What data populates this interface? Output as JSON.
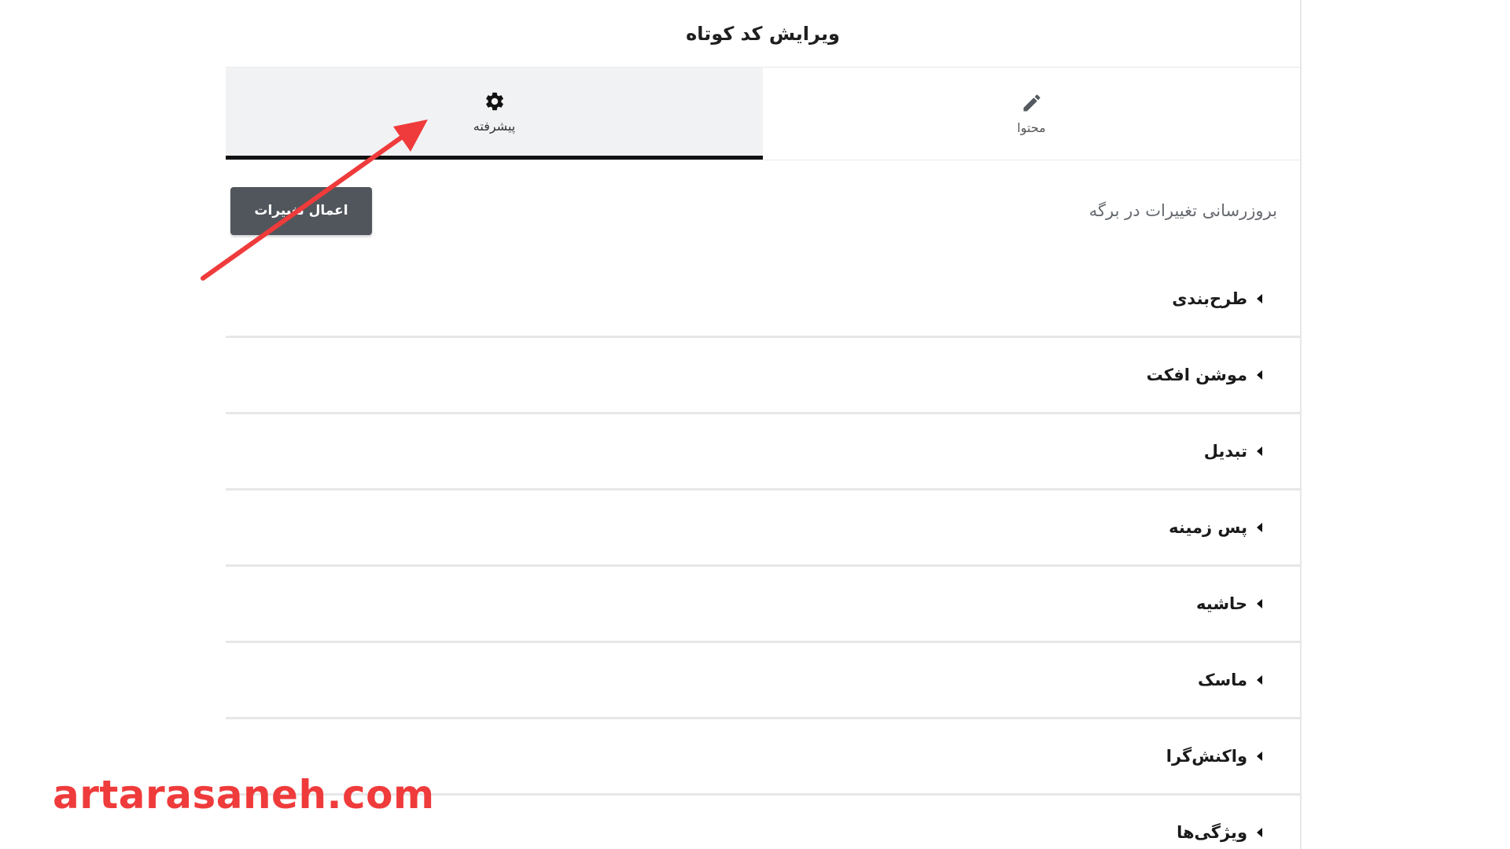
{
  "header": {
    "title": "ویرایش کد کوتاه"
  },
  "tabs": [
    {
      "label": "محتوا",
      "icon": "pencil-icon",
      "active": false
    },
    {
      "label": "پیشرفته",
      "icon": "gear-icon",
      "active": true
    }
  ],
  "sync": {
    "label": "بروزرسانی تغییرات در برگه",
    "button_label": "اعمال تغییرات"
  },
  "sections": [
    {
      "label": "طرح‌بندی"
    },
    {
      "label": "موشن افکت"
    },
    {
      "label": "تبدیل"
    },
    {
      "label": "پس زمینه"
    },
    {
      "label": "حاشیه"
    },
    {
      "label": "ماسک"
    },
    {
      "label": "واکنش‌گرا"
    },
    {
      "label": "ویژگی‌ها"
    }
  ],
  "watermark": "artarasaneh.com",
  "colors": {
    "accent_arrow": "#ef3b3b",
    "button_bg": "#50565c",
    "active_tab_bg": "#f1f2f4",
    "active_tab_border": "#111111"
  }
}
